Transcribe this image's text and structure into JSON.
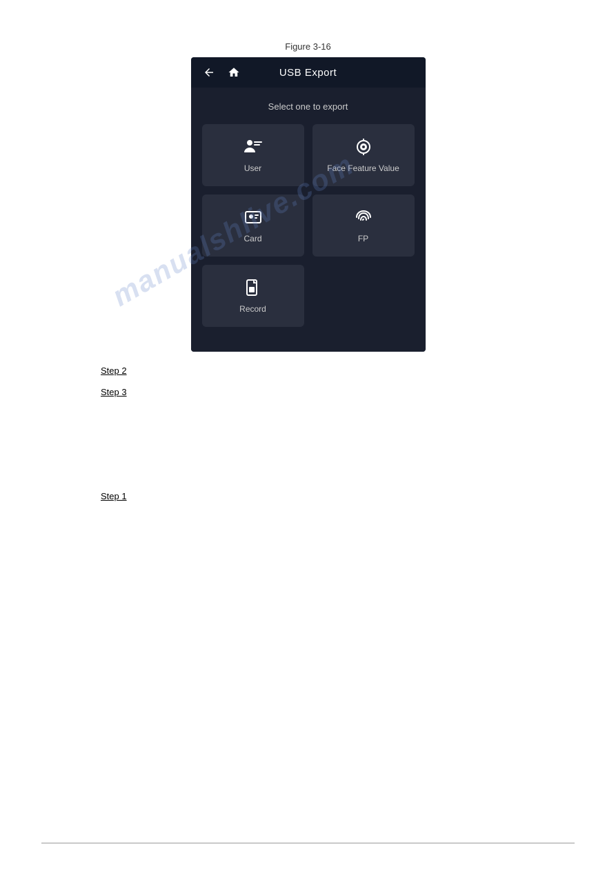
{
  "figure": {
    "label": "Figure 3-16"
  },
  "header": {
    "title": "USB Export",
    "back_icon": "back-arrow",
    "home_icon": "home"
  },
  "body": {
    "select_label": "Select one to export",
    "buttons": [
      {
        "id": "user",
        "label": "User",
        "icon": "user-list"
      },
      {
        "id": "face-feature-value",
        "label": "Face Feature Value",
        "icon": "face-scan"
      },
      {
        "id": "card",
        "label": "Card",
        "icon": "card"
      },
      {
        "id": "fp",
        "label": "FP",
        "icon": "fingerprint"
      },
      {
        "id": "record",
        "label": "Record",
        "icon": "record-file"
      }
    ]
  },
  "watermark": {
    "text": "manualshlive.com"
  },
  "steps": [
    {
      "label": "Step 2"
    },
    {
      "label": "Step 3"
    },
    {
      "label": "Step 1"
    }
  ]
}
